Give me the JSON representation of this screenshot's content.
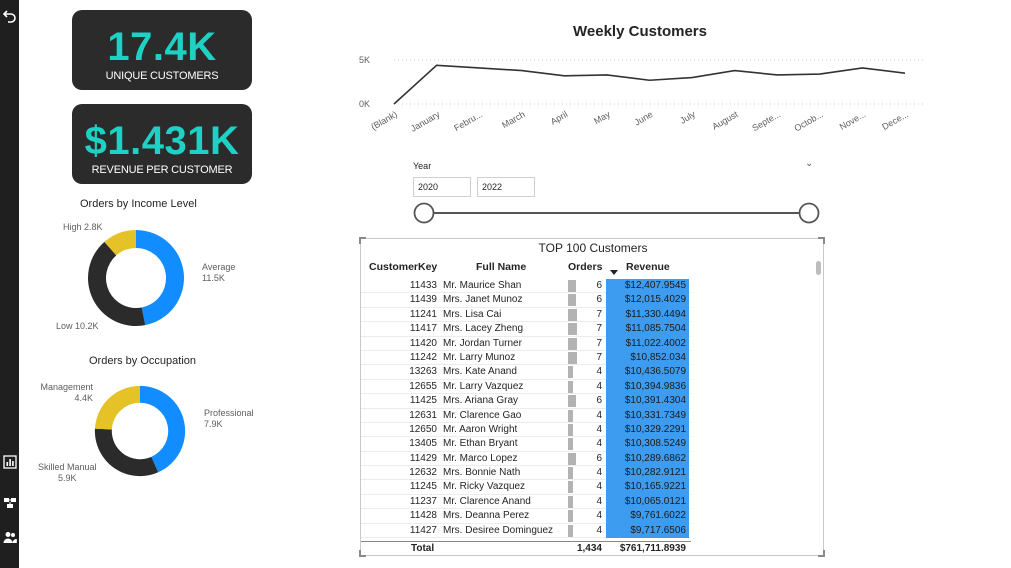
{
  "rail": {
    "icons": [
      "back-icon",
      "report-icon",
      "model-icon",
      "users-icon"
    ]
  },
  "kpis": [
    {
      "value": "17.4K",
      "label": "UNIQUE CUSTOMERS"
    },
    {
      "value": "$1.431K",
      "label": "REVENUE PER CUSTOMER"
    }
  ],
  "income_donut": {
    "title": "Orders by Income Level",
    "slices": [
      {
        "name": "Average",
        "value": "11.5K",
        "num": 11.5,
        "color": "#118dff"
      },
      {
        "name": "Low",
        "value": "10.2K",
        "num": 10.2,
        "color": "#2b2b2b"
      },
      {
        "name": "High",
        "value": "2.8K",
        "num": 2.8,
        "color": "#e6c229"
      }
    ]
  },
  "occupation_donut": {
    "title": "Orders by Occupation",
    "slices": [
      {
        "name": "Professional",
        "value": "7.9K",
        "num": 7.9,
        "color": "#118dff"
      },
      {
        "name": "Skilled Manual",
        "value": "5.9K",
        "num": 5.9,
        "color": "#2b2b2b"
      },
      {
        "name": "Management",
        "value": "4.4K",
        "num": 4.4,
        "color": "#e6c229"
      }
    ]
  },
  "chart_data": {
    "type": "line",
    "title": "Weekly Customers",
    "categories": [
      "(Blank)",
      "January",
      "Febru...",
      "March",
      "April",
      "May",
      "June",
      "July",
      "August",
      "Septe...",
      "Octob...",
      "Nove...",
      "Dece..."
    ],
    "values": [
      0,
      4400,
      4100,
      3800,
      3200,
      3300,
      2700,
      3000,
      3800,
      3300,
      3400,
      4100,
      3500
    ],
    "yticks": [
      "5K",
      "0K"
    ],
    "ylim": [
      0,
      5000
    ],
    "grid": true,
    "color": "#333333"
  },
  "slicer": {
    "title": "Year",
    "from": "2020",
    "to": "2022"
  },
  "table": {
    "title": "TOP 100 Customers",
    "headers": {
      "key": "CustomerKey",
      "name": "Full Name",
      "orders": "Orders",
      "revenue": "Revenue"
    },
    "rows": [
      {
        "key": "11433",
        "name": "Mr. Maurice Shan",
        "orders": "6",
        "revenue": "$12,407.9545",
        "o": 6
      },
      {
        "key": "11439",
        "name": "Mrs. Janet Munoz",
        "orders": "6",
        "revenue": "$12,015.4029",
        "o": 6
      },
      {
        "key": "11241",
        "name": "Mrs. Lisa Cai",
        "orders": "7",
        "revenue": "$11,330.4494",
        "o": 7
      },
      {
        "key": "11417",
        "name": "Mrs. Lacey Zheng",
        "orders": "7",
        "revenue": "$11,085.7504",
        "o": 7
      },
      {
        "key": "11420",
        "name": "Mr. Jordan Turner",
        "orders": "7",
        "revenue": "$11,022.4002",
        "o": 7
      },
      {
        "key": "11242",
        "name": "Mr. Larry Munoz",
        "orders": "7",
        "revenue": "$10,852.034",
        "o": 7
      },
      {
        "key": "13263",
        "name": "Mrs. Kate Anand",
        "orders": "4",
        "revenue": "$10,436.5079",
        "o": 4
      },
      {
        "key": "12655",
        "name": "Mr. Larry Vazquez",
        "orders": "4",
        "revenue": "$10,394.9836",
        "o": 4
      },
      {
        "key": "11425",
        "name": "Mrs. Ariana Gray",
        "orders": "6",
        "revenue": "$10,391.4304",
        "o": 6
      },
      {
        "key": "12631",
        "name": "Mr. Clarence Gao",
        "orders": "4",
        "revenue": "$10,331.7349",
        "o": 4
      },
      {
        "key": "12650",
        "name": "Mr. Aaron Wright",
        "orders": "4",
        "revenue": "$10,329.2291",
        "o": 4
      },
      {
        "key": "13405",
        "name": "Mr. Ethan Bryant",
        "orders": "4",
        "revenue": "$10,308.5249",
        "o": 4
      },
      {
        "key": "11429",
        "name": "Mr. Marco Lopez",
        "orders": "6",
        "revenue": "$10,289.6862",
        "o": 6
      },
      {
        "key": "12632",
        "name": "Mrs. Bonnie Nath",
        "orders": "4",
        "revenue": "$10,282.9121",
        "o": 4
      },
      {
        "key": "11245",
        "name": "Mr. Ricky Vazquez",
        "orders": "4",
        "revenue": "$10,165.9221",
        "o": 4
      },
      {
        "key": "11237",
        "name": "Mr. Clarence Anand",
        "orders": "4",
        "revenue": "$10,065.0121",
        "o": 4
      },
      {
        "key": "11428",
        "name": "Mrs. Deanna Perez",
        "orders": "4",
        "revenue": "$9,761.6022",
        "o": 4
      },
      {
        "key": "11427",
        "name": "Mrs. Desiree Dominguez",
        "orders": "4",
        "revenue": "$9,717.6506",
        "o": 4
      }
    ],
    "total": {
      "label": "Total",
      "orders": "1,434",
      "revenue": "$761,711.8939"
    }
  }
}
